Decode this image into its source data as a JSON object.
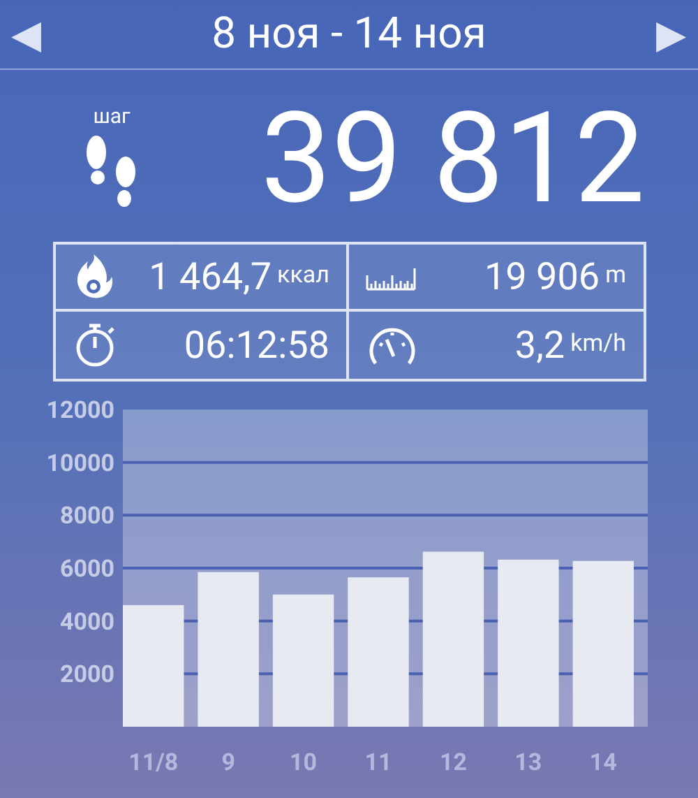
{
  "header": {
    "prev": "◀",
    "title": "8 ноя - 14 ноя",
    "next": "▶"
  },
  "steps": {
    "label": "шаг",
    "value": "39 812"
  },
  "stats": [
    {
      "kind": "calories",
      "value": "1 464,7",
      "unit": "ккал"
    },
    {
      "kind": "distance",
      "value": "19 906",
      "unit": "m"
    },
    {
      "kind": "time",
      "value": "06:12:58"
    },
    {
      "kind": "speed",
      "value": "3,2",
      "unit": "km/h"
    }
  ],
  "chart_data": {
    "type": "bar",
    "categories": [
      "11/8",
      "9",
      "10",
      "11",
      "12",
      "13",
      "14"
    ],
    "grid": true,
    "series": [
      {
        "color": "#e8eaf2",
        "values": [
          4600,
          5850,
          5000,
          5650,
          6620,
          6320,
          6270
        ]
      }
    ],
    "ylim": [
      0,
      12000
    ],
    "yticks": [
      2000,
      4000,
      6000,
      8000,
      10000,
      12000
    ]
  }
}
